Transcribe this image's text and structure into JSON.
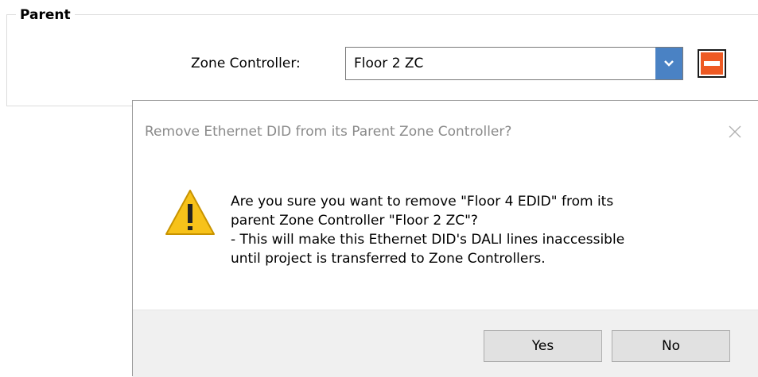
{
  "parent_group": {
    "title": "Parent",
    "zone_controller_label": "Zone Controller:",
    "zone_controller_value": "Floor 2 ZC",
    "dropdown_icon": "chevron-down-icon",
    "remove_icon": "minus-icon",
    "remove_color": "#ee5a24"
  },
  "dialog": {
    "title": "Remove Ethernet DID from its Parent Zone Controller?",
    "icon": "warning-icon",
    "message": "Are you sure you want to remove \"Floor 4 EDID\" from its\nparent Zone Controller \"Floor 2 ZC\"?\n- This will make this Ethernet DID's DALI lines inaccessible\nuntil project is transferred to Zone Controllers.",
    "yes_label": "Yes",
    "no_label": "No"
  }
}
